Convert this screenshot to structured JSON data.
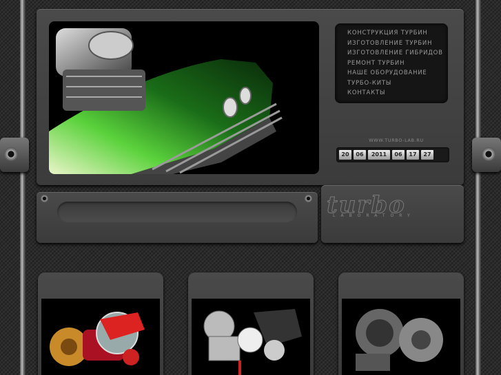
{
  "menu": {
    "items": [
      {
        "label": "Конструкция турбин"
      },
      {
        "label": "Изготовление турбин"
      },
      {
        "label": "Изготовление гибридов"
      },
      {
        "label": "Ремонт турбин"
      },
      {
        "label": "Наше оборудование"
      },
      {
        "label": "Турбо-киты"
      },
      {
        "label": "Контакты"
      }
    ]
  },
  "site": {
    "url": "www.turbo-lab.ru"
  },
  "datetime": {
    "day": "20",
    "month": "06",
    "year": "2011",
    "hour": "06",
    "minute": "17",
    "second": "27"
  },
  "logo": {
    "title": "turbo",
    "subtitle": "LABORATORY"
  },
  "colors": {
    "accent_green": "#3cff3c",
    "panel": "#3f3f3f"
  }
}
